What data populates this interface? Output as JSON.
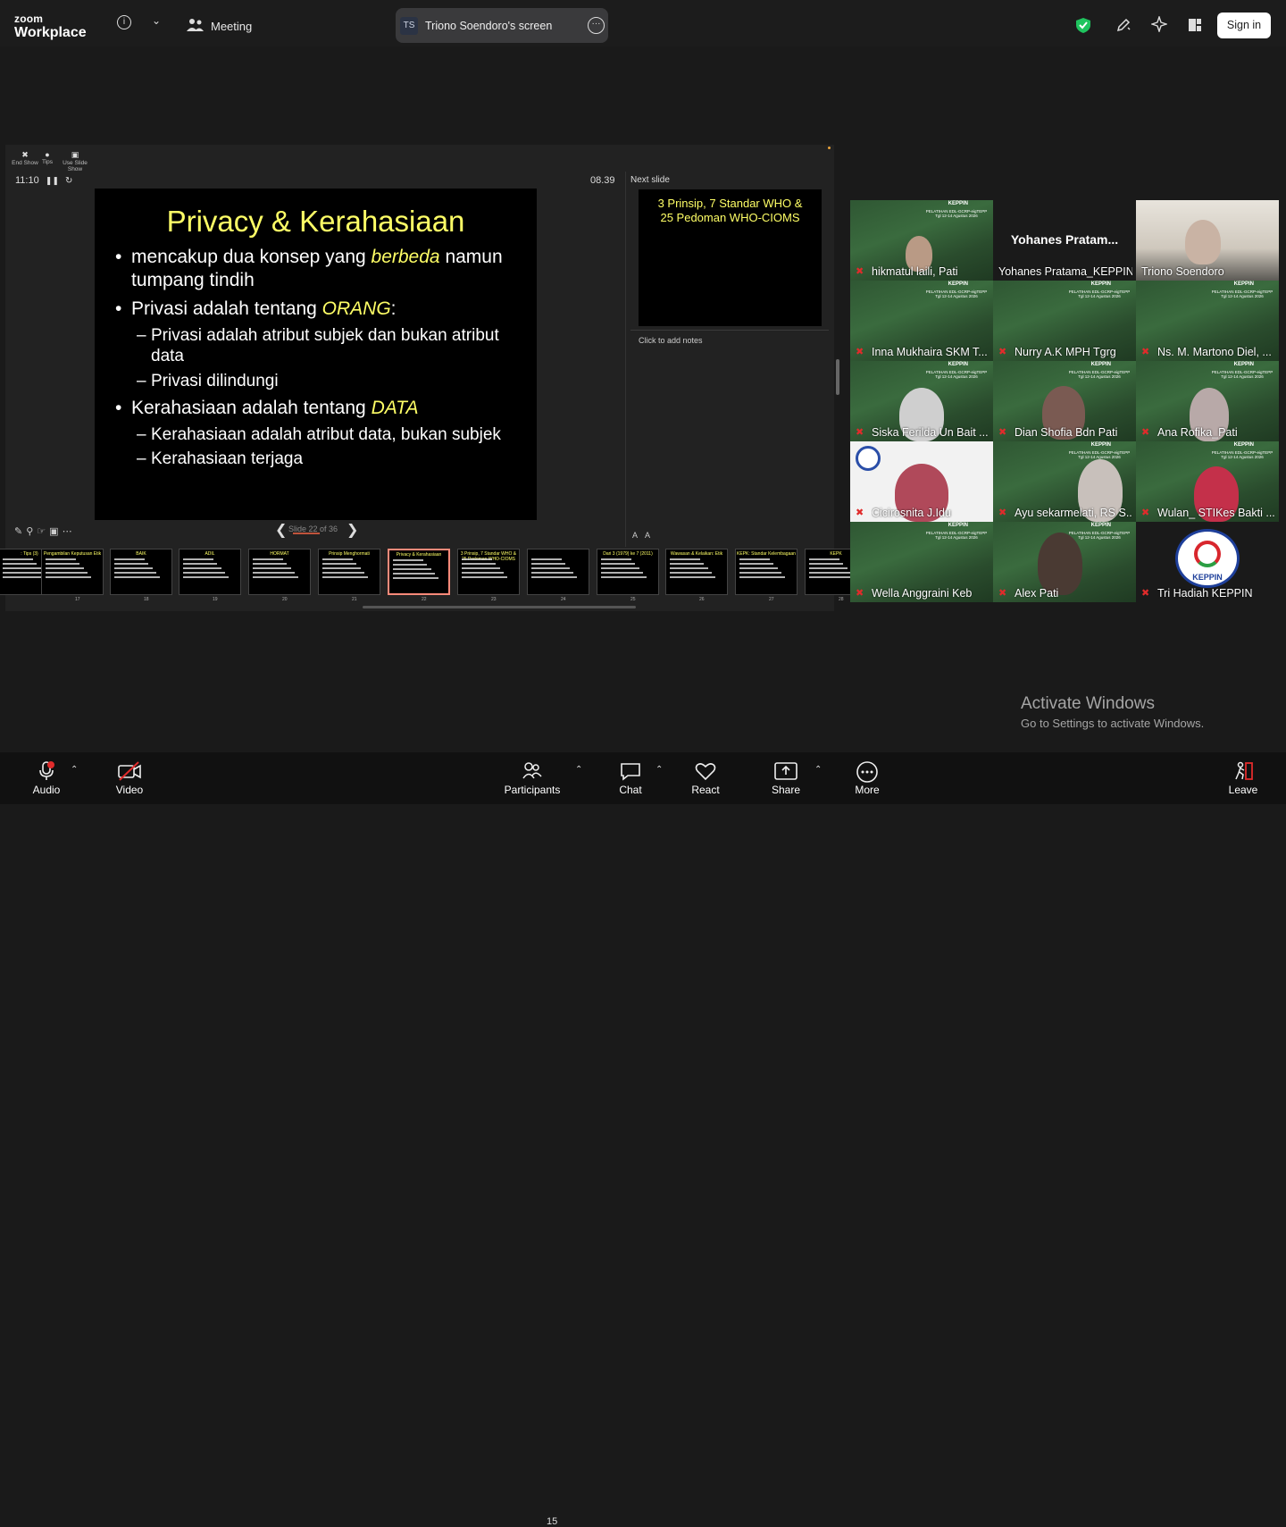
{
  "topbar": {
    "logo_top": "zoom",
    "logo_bottom": "Workplace",
    "meeting_label": "Meeting",
    "share_initials": "TS",
    "share_title": "Triono Soendoro's screen",
    "signin": "Sign in"
  },
  "presenter": {
    "toolbar": [
      "End Show",
      "Tips",
      "Use Slide Show"
    ],
    "timer": "11:10",
    "clock": "08.39",
    "next_label": "Next slide",
    "notes_placeholder": "Click to add notes",
    "slide_counter": "Slide 22 of 36",
    "font_btns": [
      "A",
      "A"
    ]
  },
  "slide": {
    "title": "Privacy & Kerahasiaan",
    "b1_a": "mencakup dua konsep yang ",
    "b1_em": "berbeda",
    "b1_b": " namun",
    "b1_c": "tumpang tindih",
    "b2_a": "Privasi adalah tentang ",
    "b2_em": "ORANG",
    "b2_b": ":",
    "s1_a": "Privasi adalah atribut subjek dan bukan atribut",
    "s1_b": "data",
    "s2": "Privasi dilindungi",
    "b3_a": "Kerahasiaan adalah tentang ",
    "b3_em": "DATA",
    "s3": "Kerahasiaan adalah atribut data, bukan subjek",
    "s4": "Kerahasiaan terjaga"
  },
  "next_slide": {
    "title_line1": "3 Prinsip, 7 Standar WHO &",
    "title_line2": "25 Pedoman WHO-CIOMS"
  },
  "thumbnails": [
    {
      "num": "",
      "title": ": Tips (3)"
    },
    {
      "num": "17",
      "title": "Pengambilan Keputusan Etik"
    },
    {
      "num": "18",
      "title": "BAIK"
    },
    {
      "num": "19",
      "title": "ADIL"
    },
    {
      "num": "20",
      "title": "HORMAT"
    },
    {
      "num": "21",
      "title": "Prinsip Menghormati"
    },
    {
      "num": "22",
      "title": "Privacy & Kerahasiaan"
    },
    {
      "num": "23",
      "title": "3 Prinsip, 7 Standar WHO & 25 Pedoman WHO-CIOMS"
    },
    {
      "num": "24",
      "title": ""
    },
    {
      "num": "25",
      "title": "Dari 3 (1979) ke 7 (2011)"
    },
    {
      "num": "26",
      "title": "Wawasan & Kelaikan: Etik"
    },
    {
      "num": "27",
      "title": "KEPK: Standar Kelembagaan"
    },
    {
      "num": "28",
      "title": "KEPK"
    }
  ],
  "participants": [
    {
      "name": "hikmatul laili, Pati",
      "muted": true
    },
    {
      "name": "Yohanes Pratama_KEPPIN",
      "muted": false,
      "display": "Yohanes  Pratam..."
    },
    {
      "name": "Triono Soendoro",
      "muted": false
    },
    {
      "name": "Inna Mukhaira SKM T...",
      "muted": true
    },
    {
      "name": "Nurry A.K MPH Tgrg",
      "muted": true
    },
    {
      "name": "Ns. M. Martono Diel, ...",
      "muted": true
    },
    {
      "name": "Siska Ferilda Un Bait ...",
      "muted": true
    },
    {
      "name": "Dian Shofia Bdn Pati",
      "muted": true
    },
    {
      "name": "Ana Rofika_Pati",
      "muted": true
    },
    {
      "name": "Cicirosnita J.Idu",
      "muted": true
    },
    {
      "name": "Ayu sekarmelati, RS S...",
      "muted": true
    },
    {
      "name": "Wulan_ STIKes Bakti ...",
      "muted": true
    },
    {
      "name": "Wella Anggraini Keb",
      "muted": true
    },
    {
      "name": "Alex  Pati",
      "muted": true
    },
    {
      "name": "Tri Hadiah KEPPIN",
      "muted": true
    }
  ],
  "tile_banner": "PELATIHAN EDL-GCRP-eigTEPP Tgl 12-14 Agustus 2026",
  "keppin_logo": "KEPPIN",
  "watermark": {
    "title": "Activate Windows",
    "subtitle": "Go to Settings to activate Windows."
  },
  "bottombar": {
    "audio": "Audio",
    "video": "Video",
    "participants": "Participants",
    "participants_count": "15",
    "chat": "Chat",
    "react": "React",
    "share": "Share",
    "more": "More",
    "leave": "Leave"
  },
  "colors": {
    "slide_title": "#ffff66",
    "active_speaker": "#27d06a",
    "muted_mic": "#e02b2b",
    "tile_bg": "#2f5733"
  }
}
